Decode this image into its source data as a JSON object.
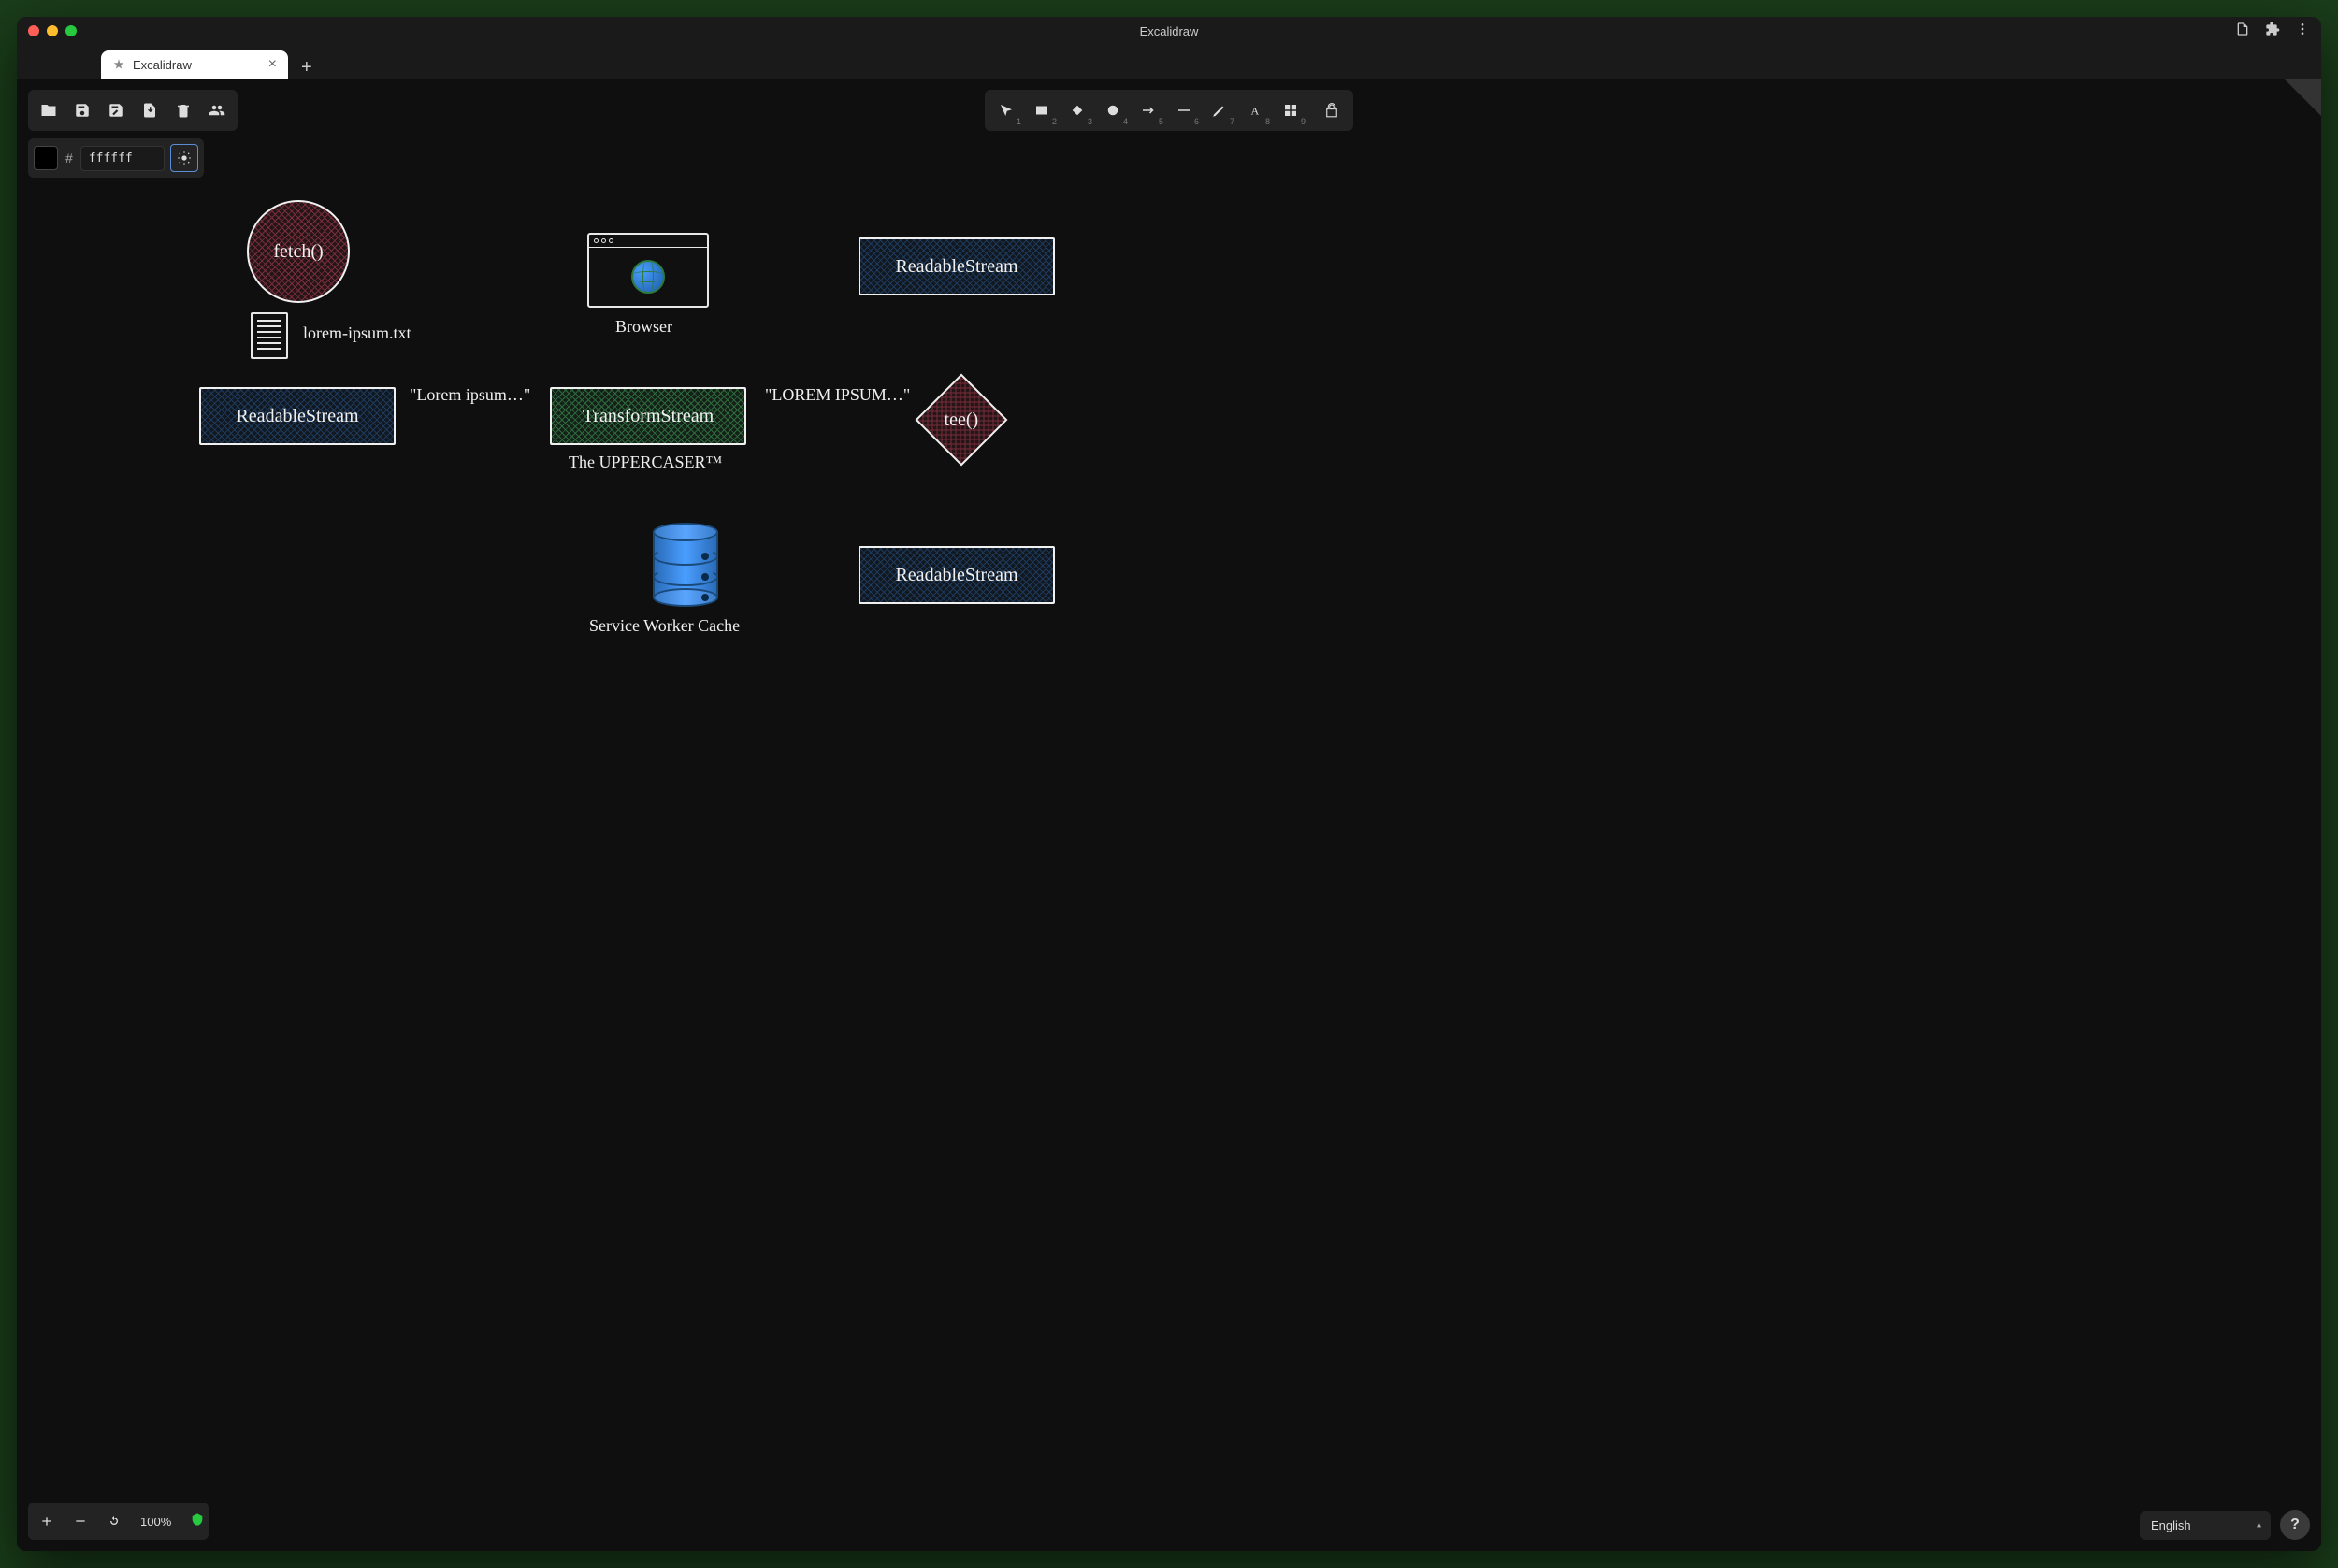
{
  "window": {
    "title": "Excalidraw"
  },
  "tabs": {
    "active": {
      "label": "Excalidraw"
    }
  },
  "color": {
    "hex": "ffffff"
  },
  "tools": {
    "items": [
      "1",
      "2",
      "3",
      "4",
      "5",
      "6",
      "7",
      "8",
      "9"
    ]
  },
  "zoom": {
    "level": "100%"
  },
  "language": {
    "selected": "English"
  },
  "diagram": {
    "fetch": "fetch()",
    "file": "lorem-ipsum.txt",
    "readable1": "ReadableStream",
    "edge1": "\"Lorem ipsum…\"",
    "transform": "TransformStream",
    "transform_sub": "The UPPERCASER™",
    "edge2": "\"LOREM IPSUM…\"",
    "tee": "tee()",
    "readable2": "ReadableStream",
    "readable3": "ReadableStream",
    "browser": "Browser",
    "cache": "Service Worker Cache"
  }
}
